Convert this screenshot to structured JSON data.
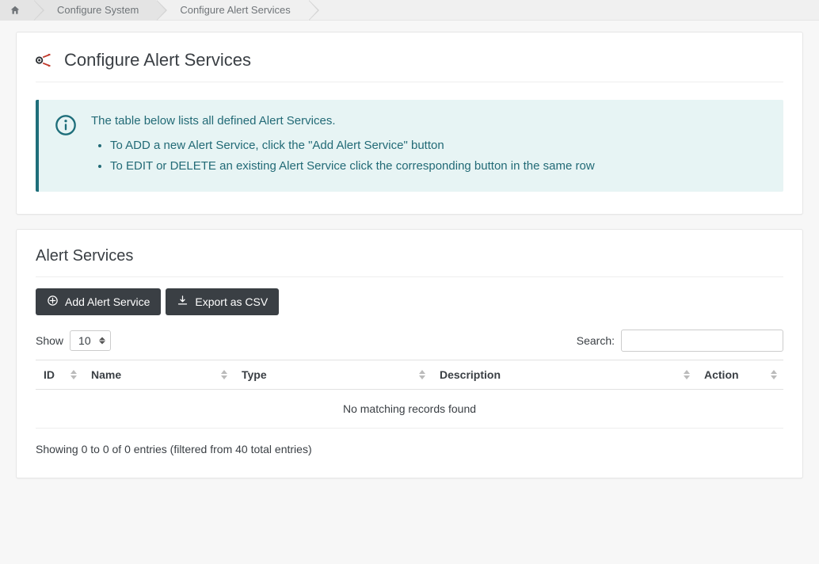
{
  "breadcrumb": {
    "items": [
      {
        "label": "Configure System"
      },
      {
        "label": "Configure Alert Services"
      }
    ]
  },
  "header": {
    "title": "Configure Alert Services"
  },
  "callout": {
    "intro": "The table below lists all defined Alert Services.",
    "bullets": [
      "To ADD a new Alert Service, click the \"Add Alert Service\" button",
      "To EDIT or DELETE an existing Alert Service click the corresponding button in the same row"
    ]
  },
  "section": {
    "title": "Alert Services"
  },
  "buttons": {
    "add_label": "Add Alert Service",
    "export_label": "Export as CSV"
  },
  "datatable": {
    "show_label": "Show",
    "page_length": "10",
    "search_label": "Search:",
    "search_value": "",
    "columns": {
      "id": "ID",
      "name": "Name",
      "type": "Type",
      "description": "Description",
      "action": "Action"
    },
    "empty_message": "No matching records found",
    "info_text": "Showing 0 to 0 of 0 entries (filtered from 40 total entries)"
  }
}
